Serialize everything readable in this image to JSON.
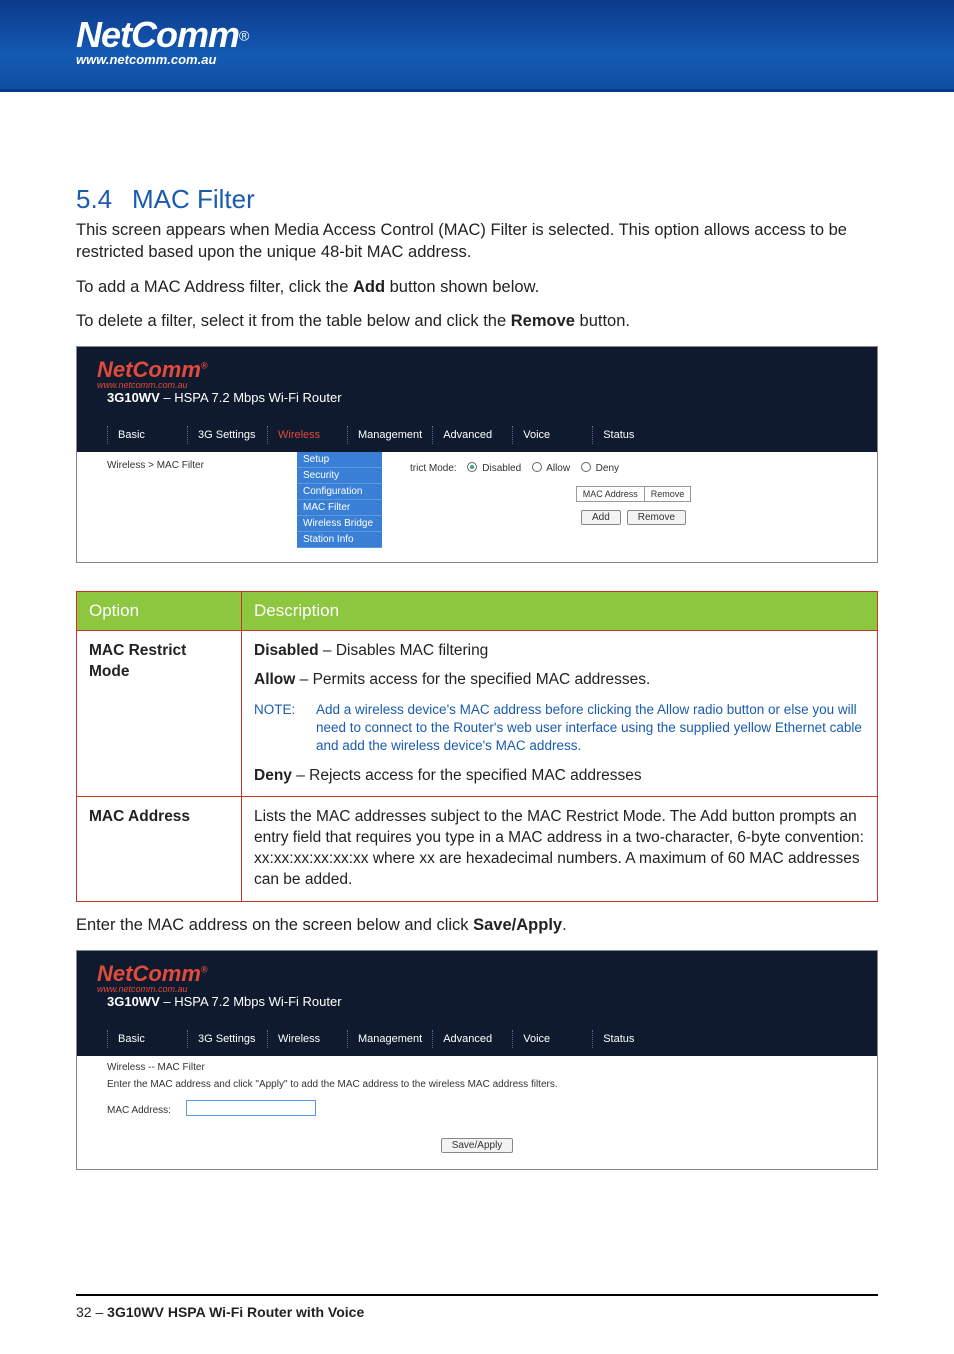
{
  "brand": {
    "name": "NetComm",
    "reg": "®",
    "url": "www.netcomm.com.au"
  },
  "section": {
    "num": "5.4",
    "title": "MAC Filter"
  },
  "paragraphs": {
    "intro": "This screen appears when Media Access Control (MAC) Filter is selected. This option allows access to be restricted based upon the unique 48-bit MAC address.",
    "add_pre": "To add a MAC Address filter, click the ",
    "add_bold": "Add",
    "add_post": " button shown below.",
    "del_pre": "To delete a filter, select it from the table below and click the ",
    "del_bold": "Remove",
    "del_post": " button.",
    "enter_pre": "Enter the MAC address on the screen below and click ",
    "enter_bold": "Save/Apply",
    "enter_post": "."
  },
  "router": {
    "model": "3G10WV",
    "subtitle": " – HSPA 7.2 Mbps Wi-Fi Router",
    "tabs": [
      "Basic",
      "3G Settings",
      "Wireless",
      "Management",
      "Advanced",
      "Voice",
      "Status"
    ],
    "active_tab": "Wireless",
    "breadcrumb1": "Wireless > MAC Filter",
    "submenu": [
      "Setup",
      "Security",
      "Configuration",
      "MAC Filter",
      "Wireless Bridge",
      "Station Info"
    ],
    "restrict_label": "trict Mode:",
    "restrict_opts": [
      "Disabled",
      "Allow",
      "Deny"
    ],
    "mini_headers": [
      "MAC Address",
      "Remove"
    ],
    "btn_add": "Add",
    "btn_remove": "Remove",
    "breadcrumb2": "Wireless -- MAC Filter",
    "hint2": "Enter the MAC address and click \"Apply\" to add the MAC address to the wireless MAC address filters.",
    "field_label": "MAC Address:",
    "btn_save": "Save/Apply"
  },
  "table": {
    "head_option": "Option",
    "head_desc": "Description",
    "row1_key": "MAC Restrict Mode",
    "row1_disabled_b": "Disabled",
    "row1_disabled_t": " – Disables MAC filtering",
    "row1_allow_b": "Allow",
    "row1_allow_t": " – Permits access for the specified MAC addresses.",
    "note_label": "NOTE:",
    "note_text": "Add a wireless device's MAC address before clicking the Allow radio button or else you will need to connect to the Router's web user interface using the supplied yellow Ethernet cable and add the wireless device's MAC address.",
    "row1_deny_b": "Deny",
    "row1_deny_t": " – Rejects access for the specified MAC addresses",
    "row2_key": "MAC Address",
    "row2_text": "Lists the MAC addresses subject to the MAC Restrict Mode. The Add button prompts an entry field that requires you type in a MAC address in a two-character, 6-byte convention: xx:xx:xx:xx:xx:xx where xx are hexadecimal numbers. A maximum of 60 MAC addresses can be added."
  },
  "footer": {
    "page": "32",
    "sep": " – ",
    "title": "3G10WV HSPA Wi-Fi Router with Voice"
  }
}
